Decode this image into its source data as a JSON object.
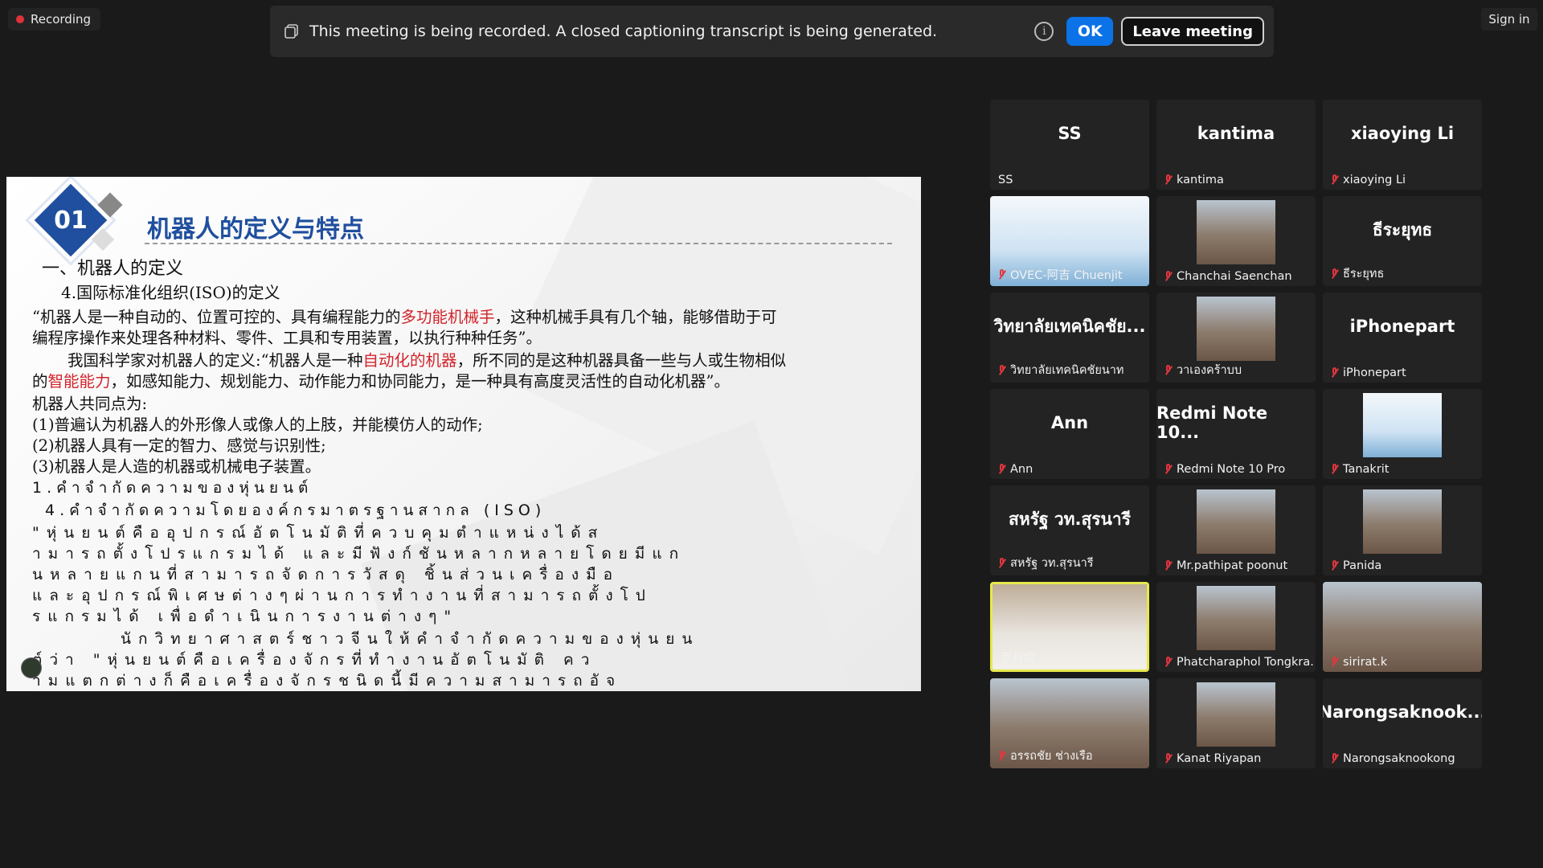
{
  "recording": {
    "label": "Recording"
  },
  "banner": {
    "message": "This meeting is being recorded. A closed captioning transcript is being generated.",
    "info_glyph": "i",
    "ok_label": "OK",
    "leave_label": "Leave meeting"
  },
  "signin": {
    "label": "Sign in"
  },
  "slide": {
    "badge_number": "01",
    "title": "机器人的定义与特点",
    "heading": "一、机器人的定义",
    "subheading": "4.国际标准化组织(ISO)的定义",
    "para1_a": "“机器人是一种自动的、位置可控的、具有编程能力的",
    "para1_red": "多功能机械手",
    "para1_b": "，这种机械手具有几个轴，能够借助于可",
    "para1_c": "编程序操作来处理各种材料、零件、工具和专用装置，以执行种种任务”。",
    "para2_a": "我国科学家对机器人的定义:“机器人是一种",
    "para2_red": "自动化的机器",
    "para2_b": "，所不同的是这种机器具备一些与人或生物相似",
    "para2_c1": "的",
    "para2_red2": "智能能力",
    "para2_c2": "，如感知能力、规划能力、动作能力和协同能力，是一种具有高度灵活性的自动化机器”。",
    "common_title": "机器人共同点为:",
    "point1": "(1)普遍认为机器人的外形像人或像人的上肢，并能模仿人的动作;",
    "point2": "(2)机器人具有一定的智力、感觉与识别性;",
    "point3": "(3)机器人是人造的机器或机械电子装置。",
    "thai1": "1.คําจํากัดความของหุ่นยนต์",
    "thai2": "4.คําจํากัดความโดยองค์กรมาตรฐานสากล (ISO)",
    "thai3": "\"หุ่นยนต์คืออุปกรณ์อัตโนมัติที่ควบคุมตําแหน่งได้ส",
    "thai4": "ามารถตั้งโปรแกรมได้ และมีฟังก์ชันหลากหลายโดยมีแก",
    "thai5": "นหลายแกนที่สามารถจัดการวัสดุ ชิ้นส่วนเครื่องมือ",
    "thai6": "และอุปกรณ์พิเศษต่างๆผ่านการทํางานที่สามารถตั้งโป",
    "thai7": "รแกรมได้ เพื่อดําเนินการงานต่างๆ\"",
    "thai8": "นักวิทยาศาสตร์ชาวจีนให้คําจํากัดความของหุ่นยน",
    "thai9": "ต์ว่า \"หุ่นยนต์คือเครื่องจักรที่ทํางานอัตโนมัติ คว",
    "thai10": "ามแตกต่างก็คือเครื่องจักรชนิดนี้มีความสามารถอัจ"
  },
  "participants": [
    {
      "display": "SS",
      "label": "SS",
      "muted": false
    },
    {
      "display": "kantima",
      "label": "kantima",
      "muted": true
    },
    {
      "display": "xiaoying Li",
      "label": "xiaoying Li",
      "muted": true
    },
    {
      "display": "",
      "label": "OVEC-阿吉 Chuenjit",
      "muted": true,
      "video": "slide-share"
    },
    {
      "display": "",
      "label": "Chanchai Saenchan",
      "muted": true,
      "video": "person"
    },
    {
      "display": "ธีระยุทธ",
      "label": "ธีระยุทธ",
      "muted": true
    },
    {
      "display": "วิทยาลัยเทคนิคชัย...",
      "label": "วิทยาลัยเทคนิคชัยนาท",
      "muted": true
    },
    {
      "display": "",
      "label": "วาเองคร้าบบ",
      "muted": true,
      "video": "person"
    },
    {
      "display": "iPhonepart",
      "label": "iPhonepart",
      "muted": true
    },
    {
      "display": "Ann",
      "label": "Ann",
      "muted": true
    },
    {
      "display": "Redmi Note 10...",
      "label": "Redmi Note 10 Pro",
      "muted": true
    },
    {
      "display": "",
      "label": "Tanakrit",
      "muted": true,
      "video": "slide-share"
    },
    {
      "display": "สหรัฐ วท.สุรนารี",
      "label": "สหรัฐ วท.สุรนารี",
      "muted": true
    },
    {
      "display": "",
      "label": "Mr.pathipat poonut",
      "muted": true,
      "video": "person"
    },
    {
      "display": "",
      "label": "Panida",
      "muted": true,
      "video": "person"
    },
    {
      "display": "",
      "label": "罗肖培",
      "muted": false,
      "video": "room",
      "active": true
    },
    {
      "display": "",
      "label": "Phatcharaphol Tongkra...",
      "muted": true,
      "video": "person"
    },
    {
      "display": "",
      "label": "sirirat.k",
      "muted": true,
      "video": "person"
    },
    {
      "display": "",
      "label": "อรรถชัย ช่างเรือ",
      "muted": true,
      "video": "person"
    },
    {
      "display": "",
      "label": "Kanat Riyapan",
      "muted": true,
      "video": "person"
    },
    {
      "display": "Narongsaknook...",
      "label": "Narongsaknookong",
      "muted": true
    }
  ],
  "colors": {
    "accent": "#0b72e7",
    "active_speaker": "#e6e94a",
    "muted_mic": "#e3363f",
    "slide_title": "#1f4f9e",
    "slide_red": "#d2232a"
  }
}
